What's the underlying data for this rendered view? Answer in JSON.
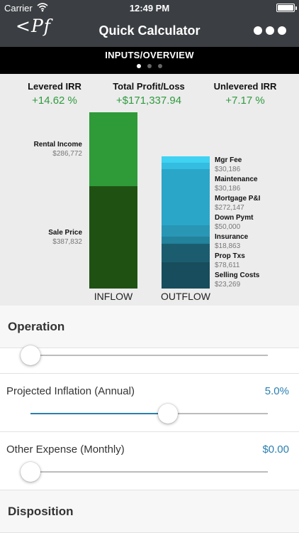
{
  "status_bar": {
    "carrier": "Carrier",
    "time": "12:49 PM"
  },
  "nav": {
    "logo": "<Pf",
    "title": "Quick Calculator",
    "more_icon": "more-dots-icon"
  },
  "section": {
    "title": "INPUTS/OVERVIEW",
    "page_count": 3,
    "active_page": 0
  },
  "metrics": [
    {
      "label": "Levered IRR",
      "value": "+14.62 %"
    },
    {
      "label": "Total Profit/Loss",
      "value": "+$171,337.94"
    },
    {
      "label": "Unlevered IRR",
      "value": "+7.17 %"
    }
  ],
  "chart": {
    "inflow_label": "INFLOW",
    "outflow_label": "OUTFLOW",
    "inflow": [
      {
        "label": "Rental Income",
        "value": "$286,772",
        "color": "#2e9a38"
      },
      {
        "label": "Sale Price",
        "value": "$387,832",
        "color": "#1f5212"
      }
    ],
    "outflow": [
      {
        "label": "Mgr Fee",
        "value": "$30,186",
        "color": "#3fd2f2"
      },
      {
        "label": "Maintenance",
        "value": "$30,186",
        "color": "#34bde0"
      },
      {
        "label": "Mortgage P&I",
        "value": "$272,147",
        "color": "#2aa6c8"
      },
      {
        "label": "Down Pymt",
        "value": "$50,000",
        "color": "#2996b5"
      },
      {
        "label": "Insurance",
        "value": "$18,863",
        "color": "#23829c"
      },
      {
        "label": "Prop Txs",
        "value": "$78,611",
        "color": "#1b5d6f"
      },
      {
        "label": "Selling Costs",
        "value": "$23,269",
        "color": "#174d5c"
      }
    ]
  },
  "settings": {
    "operation_header": "Operation",
    "projected_inflation": {
      "label": "Projected Inflation (Annual)",
      "value": "5.0%",
      "slider_fraction": 0.58
    },
    "other_expense": {
      "label": "Other Expense (Monthly)",
      "value": "$0.00",
      "slider_fraction": 0.0
    },
    "operation_slider_fraction": 0.0,
    "disposition_header": "Disposition"
  },
  "colors": {
    "accent": "#2b7fb0",
    "positive": "#2f9a3f",
    "nav_bg": "#3b3e42"
  }
}
